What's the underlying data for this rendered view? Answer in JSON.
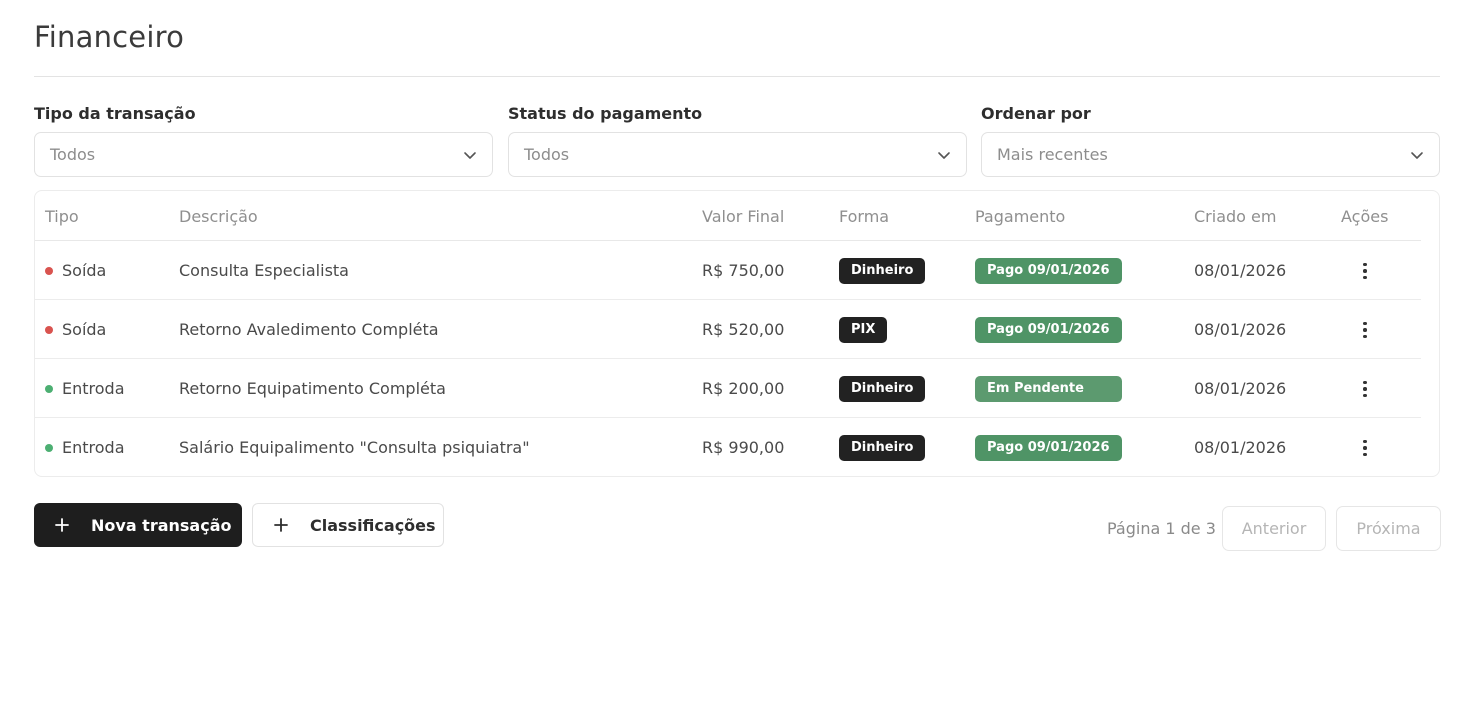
{
  "page": {
    "title": "Financeiro"
  },
  "filters": [
    {
      "label": "Tipo da transação",
      "value": "Todos"
    },
    {
      "label": "Status do pagamento",
      "value": "Todos"
    },
    {
      "label": "Ordenar por",
      "value": "Mais recentes"
    }
  ],
  "table": {
    "headers": {
      "tipo": "Tipo",
      "descricao": "Descrição",
      "valor": "Valor Final",
      "forma": "Forma",
      "pagamento": "Pagamento",
      "criado": "Criado em",
      "acoes": "Ações"
    },
    "rows": [
      {
        "tipo": "Soída",
        "descricao": "Consulta Especialista",
        "valor": "R$ 750,00",
        "forma": "Dinheiro",
        "pagamento": "Pago 09/01/2026",
        "criado": "08/01/2026"
      },
      {
        "tipo": "Soída",
        "descricao": "Retorno Avaledimento Compléta",
        "valor": "R$ 520,00",
        "forma": "PIX",
        "pagamento": "Pago 09/01/2026",
        "criado": "08/01/2026"
      },
      {
        "tipo": "Entroda",
        "descricao": "Retorno Equipatimento Compléta",
        "valor": "R$ 200,00",
        "forma": "Dinheiro",
        "pagamento": "Em Pendente",
        "criado": "08/01/2026"
      },
      {
        "tipo": "Entroda",
        "descricao": "Salário Equipalimento \"Consulta psiquiatra\"",
        "valor": "R$ 990,00",
        "forma": "Dinheiro",
        "pagamento": "Pago 09/01/2026",
        "criado": "08/01/2026"
      }
    ]
  },
  "actions": {
    "new_transaction": "Nova transação",
    "classifications": "Classificações"
  },
  "pagination": {
    "info": "Página 1 de 3",
    "prev": "Anterior",
    "next": "Próxima"
  },
  "colors": {
    "saida_dot": "#d9534f",
    "entrada_dot": "#4caf72",
    "paid_badge": "#4f9466",
    "pending_badge": "#5c9a6f",
    "method_badge": "#222222",
    "primary_button": "#1e1e1e"
  },
  "icons": {
    "select_caret": "chevron-down-icon",
    "add": "plus-icon",
    "row_menu": "more-vertical-icon"
  }
}
